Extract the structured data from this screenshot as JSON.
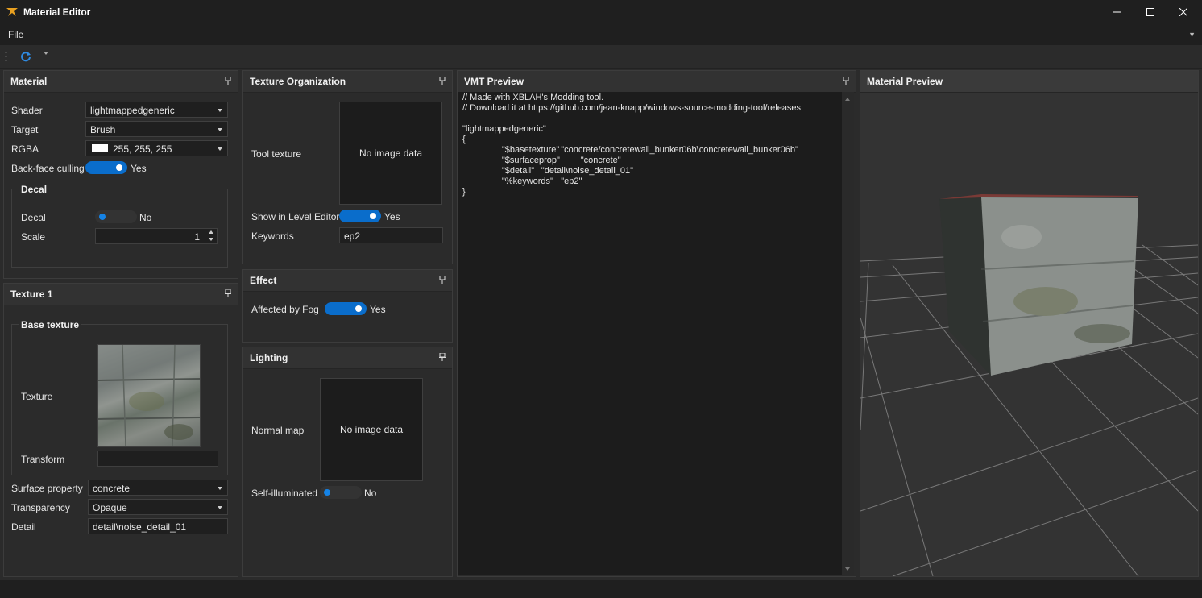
{
  "window": {
    "title": "Material Editor"
  },
  "menu": {
    "file": "File"
  },
  "material_panel": {
    "title": "Material",
    "shader_label": "Shader",
    "shader_value": "lightmappedgeneric",
    "target_label": "Target",
    "target_value": "Brush",
    "rgba_label": "RGBA",
    "rgba_value": "255, 255, 255",
    "rgba_swatch": "#ffffff",
    "backface_label": "Back-face culling",
    "backface_state": "Yes",
    "decal_group": "Decal",
    "decal_label": "Decal",
    "decal_state": "No",
    "scale_label": "Scale",
    "scale_value": "1"
  },
  "texture1_panel": {
    "title": "Texture 1",
    "base_group": "Base texture",
    "texture_label": "Texture",
    "transform_label": "Transform",
    "surface_label": "Surface property",
    "surface_value": "concrete",
    "transparency_label": "Transparency",
    "transparency_value": "Opaque",
    "detail_label": "Detail",
    "detail_value": "detail\\noise_detail_01"
  },
  "texture_org_panel": {
    "title": "Texture Organization",
    "tool_texture_label": "Tool texture",
    "no_image": "No image data",
    "show_label": "Show in Level Editor",
    "show_state": "Yes",
    "keywords_label": "Keywords",
    "keywords_value": "ep2"
  },
  "effect_panel": {
    "title": "Effect",
    "fog_label": "Affected by Fog",
    "fog_state": "Yes"
  },
  "lighting_panel": {
    "title": "Lighting",
    "normal_label": "Normal map",
    "no_image": "No image data",
    "self_illum_label": "Self-illuminated",
    "self_illum_state": "No"
  },
  "vmt_panel": {
    "title": "VMT Preview",
    "text": "// Made with XBLAH's Modding tool.\n// Download it at https://github.com/jean-knapp/windows-source-modding-tool/releases\n\n\"lightmappedgeneric\"\n{\n\t\t\"$basetexture\"\t\"concrete/concretewall_bunker06b\\concretewall_bunker06b\"\n\t\t\"$surfaceprop\"\t\"concrete\"\n\t\t\"$detail\"\t\"detail\\noise_detail_01\"\n\t\t\"%keywords\"\t\"ep2\"\n}"
  },
  "preview_panel": {
    "title": "Material Preview"
  },
  "icons": {
    "app": "app-logo-icon",
    "refresh": "refresh-icon",
    "pin": "pin-icon",
    "minimize": "minimize-icon",
    "maximize": "maximize-icon",
    "close": "close-icon"
  },
  "colors": {
    "accent": "#0a6dcb",
    "panel_bg": "#2b2b2b",
    "titlebar": "#1f1f1f"
  }
}
